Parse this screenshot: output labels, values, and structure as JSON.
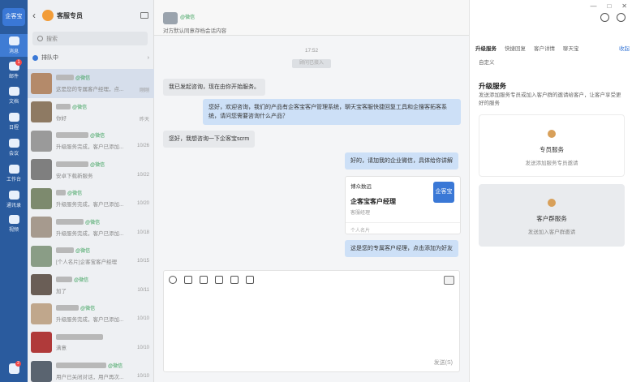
{
  "rail": {
    "logo": "企客宝",
    "items": [
      {
        "label": "消息",
        "badge": "",
        "active": true
      },
      {
        "label": "邮件",
        "badge": "1",
        "active": false
      },
      {
        "label": "文档",
        "badge": "",
        "active": false
      },
      {
        "label": "日程",
        "badge": "",
        "active": false
      },
      {
        "label": "会议",
        "badge": "",
        "active": false
      },
      {
        "label": "工作台",
        "badge": "",
        "active": false
      },
      {
        "label": "通讯录",
        "badge": "",
        "active": false
      },
      {
        "label": "视频",
        "badge": "",
        "active": false
      }
    ],
    "bottom_badge": "2"
  },
  "list": {
    "title": "客服专员",
    "search_placeholder": "搜索",
    "queue_label": "排队中",
    "conversations": [
      {
        "tag": "@微信",
        "preview": "这是您的专属客户经理，点...",
        "time": "刚刚"
      },
      {
        "tag": "@微信",
        "preview": "你好",
        "time": "昨天"
      },
      {
        "tag": "@微信",
        "preview": "升级服务完成，客户已添加...",
        "time": "10/26"
      },
      {
        "tag": "@微信",
        "preview": "安卓下载新服务",
        "time": "10/22"
      },
      {
        "tag": "@微信",
        "preview": "升级服务完成，客户已添加...",
        "time": "10/20"
      },
      {
        "tag": "@微信",
        "preview": "升级服务完成，客户已添加...",
        "time": "10/18"
      },
      {
        "tag": "@微信",
        "preview": "[个人名片]企客宝客户经理",
        "time": "10/15"
      },
      {
        "tag": "@微信",
        "preview": "加了",
        "time": "10/11"
      },
      {
        "tag": "@微信",
        "preview": "升级服务完成，客户已添加...",
        "time": "10/10"
      },
      {
        "tag": "",
        "preview": "满意",
        "time": "10/10"
      },
      {
        "tag": "@微信",
        "preview": "用户已关闭对话，用户再次...",
        "time": "10/10"
      }
    ]
  },
  "chat": {
    "contact_tag": "@微信",
    "consent_note": "对方默认同意存档会话内容",
    "timestamp": "17:52",
    "system_note": "顾问已接入",
    "messages": [
      {
        "side": "left",
        "text": "我已发起咨询，现在由你开始服务。"
      },
      {
        "side": "right",
        "text": "您好，欢迎咨询，我们的产品有企客宝客户管理系统，聊天宝客服快捷回复工具和企搜客拓客系统，请问您需要咨询什么产品？"
      },
      {
        "side": "left",
        "text": "您好，我想咨询一下企客宝scrm"
      },
      {
        "side": "right",
        "text": "好的，请加我的企业微信，具体给你讲解"
      },
      {
        "side": "right",
        "text": "这是您的专属客户经理，点击添加为好友"
      }
    ],
    "card": {
      "company": "博众数远",
      "title": "企客宝客户经理",
      "subtitle": "客服经理",
      "logo_text": "企客宝",
      "footer": "个人名片"
    },
    "send_label": "发送(S)"
  },
  "panel": {
    "tabs": [
      "升级服务",
      "快捷回复",
      "客户详情",
      "聊天宝"
    ],
    "active_tab": 0,
    "collapse_label": "收起",
    "custom_label": "自定义",
    "section_title": "升级服务",
    "section_desc": "发送添加服务专员或加入客户群的邀请给客户，让客户享受更好的服务",
    "options": [
      {
        "title": "专员服务",
        "desc": "发送添加服务专员邀请"
      },
      {
        "title": "客户群服务",
        "desc": "发送加入客户群邀请"
      }
    ]
  },
  "window": {
    "minimize": "—",
    "maximize": "□",
    "close": "✕"
  },
  "colors": {
    "accent": "#3a78d6",
    "rail": "#2a5b9e",
    "wechat_tag": "#3aa05a"
  }
}
